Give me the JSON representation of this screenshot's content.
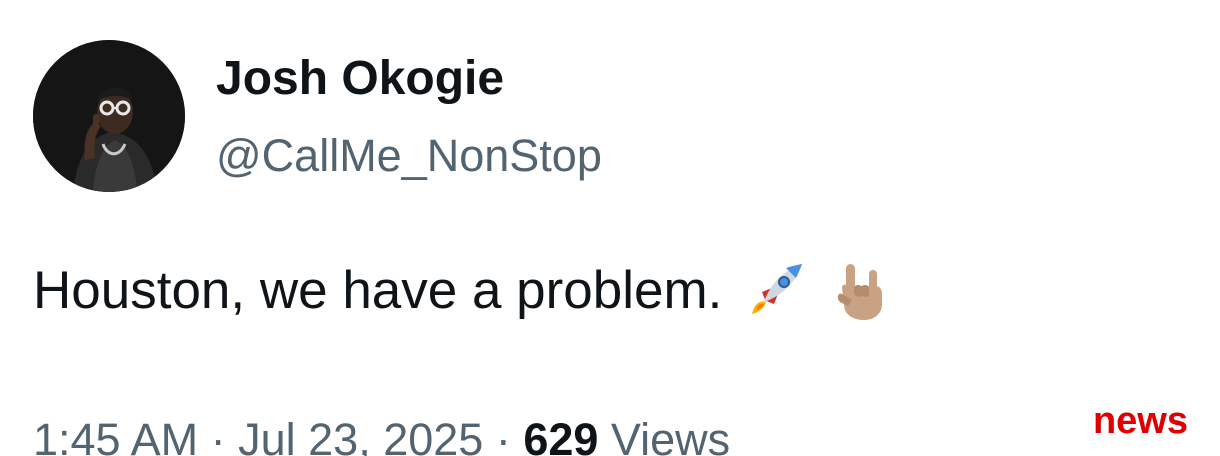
{
  "post": {
    "author": {
      "display_name": "Josh Okogie",
      "handle": "@CallMe_NonStop",
      "avatar_icon": "profile-photo"
    },
    "text": "Houston, we have a problem.",
    "emojis": [
      "rocket-emoji",
      "sign-of-the-horns-emoji"
    ],
    "meta": {
      "time": "1:45 AM",
      "separator": " · ",
      "date": "Jul 23, 2025",
      "views_count": "629",
      "views_label": "Views"
    }
  },
  "watermark": {
    "text": "news",
    "color": "#e00000"
  }
}
